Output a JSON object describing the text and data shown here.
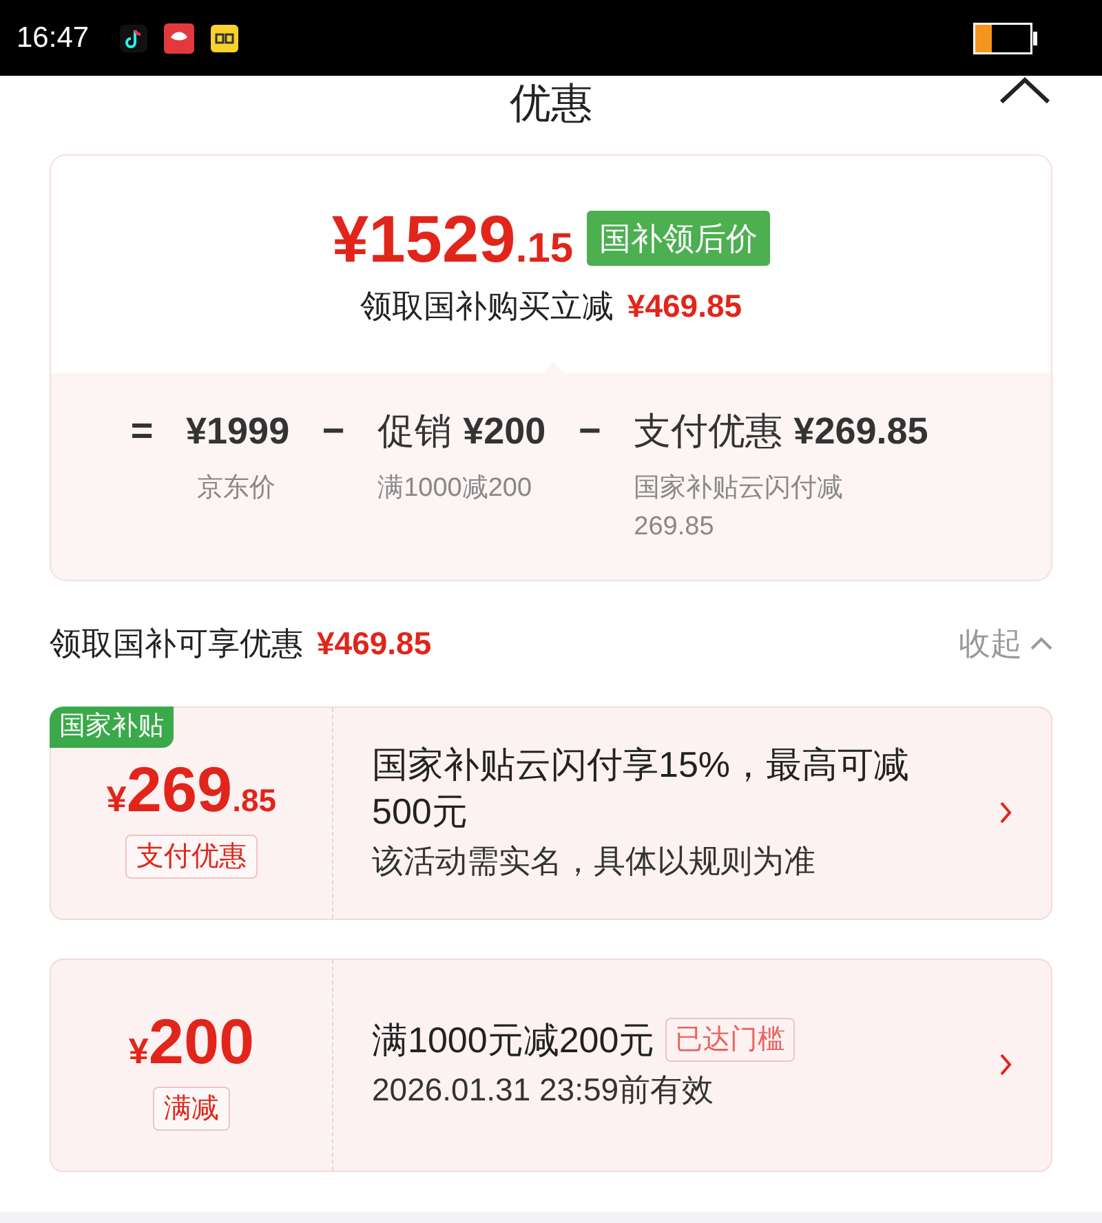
{
  "status_bar": {
    "time": "16:47"
  },
  "sheet": {
    "title": "优惠"
  },
  "summary": {
    "price_main": "¥1529",
    "price_decimal": ".15",
    "badge": "国补领后价",
    "subtitle": "领取国补购买立减",
    "subtitle_amount": "¥469.85",
    "breakdown": [
      {
        "kind": "op",
        "text": "="
      },
      {
        "kind": "item",
        "value": "¥1999",
        "note": "京东价"
      },
      {
        "kind": "op",
        "text": "−"
      },
      {
        "kind": "item",
        "label": "促销",
        "value": "¥200",
        "note": "满1000减200"
      },
      {
        "kind": "op",
        "text": "−"
      },
      {
        "kind": "item",
        "label": "支付优惠",
        "value": "¥269.85",
        "note": "国家补贴云闪付减269.85"
      }
    ]
  },
  "section": {
    "title": "领取国补可享优惠",
    "amount": "¥469.85",
    "toggle": "收起"
  },
  "coupons": [
    {
      "tag": "国家补贴",
      "currency": "¥",
      "amount": "269",
      "decimal": ".85",
      "type": "支付优惠",
      "title": "国家补贴云闪付享15%，最高可减500元",
      "note": "该活动需实名，具体以规则为准"
    },
    {
      "currency": "¥",
      "amount": "200",
      "type": "满减",
      "title": "满1000元减200元",
      "badge": "已达门槛",
      "note": "2026.01.31 23:59前有效"
    }
  ]
}
